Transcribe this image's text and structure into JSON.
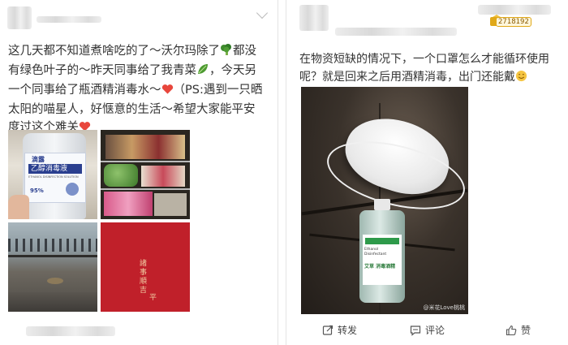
{
  "left_post": {
    "text": "这几天都不知道煮啥吃的了～沃尔玛除了",
    "text_2": "都没有绿色叶子的～昨天同事给了我青菜",
    "text_3": "，今天另一个同事给了瓶酒精消毒水～",
    "text_4": "（PS:遇到一只晒太阳的喵星人，好惬意的生活～希望大家能平安度过这个难关",
    "bottle_brand": "滴露",
    "bottle_label": "乙醇消毒液",
    "bottle_sublabel": "ETHANOL DISINFECTION SOLUTION",
    "bottle_percent": "95%",
    "red_card_text_1": "諸事順吉",
    "red_card_text_2": "平"
  },
  "right_post": {
    "user_id": "2718192",
    "text": "在物资短缺的情况下，一个口罩怎么才能循环使用呢？就是回来之后用酒精消毒，出门还能戴",
    "bottle_label": "艾草 消毒酒精",
    "bottle_sublabel": "Ethanol Disinfectant",
    "watermark": "@米花Love桃桃",
    "actions": {
      "repost": "转发",
      "comment": "评论",
      "like": "赞"
    }
  },
  "colors": {
    "heart": "#e8463c",
    "red_card": "#c0202a",
    "gold_badge": "#e0a818"
  }
}
